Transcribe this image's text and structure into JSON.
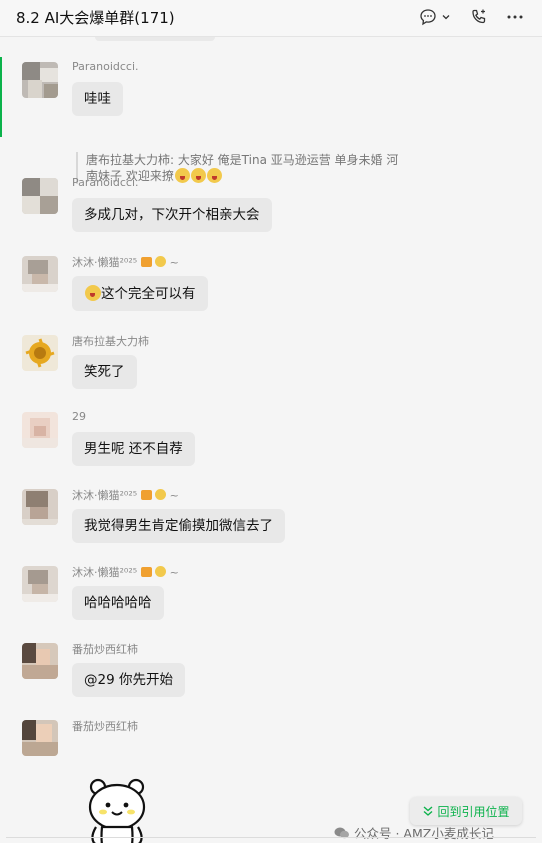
{
  "header": {
    "title": "8.2 AI大会爆单群(171)",
    "icons": [
      "chat-bubble-icon",
      "chevron-down-icon",
      "phone-icon",
      "more-icon"
    ]
  },
  "messages": [
    {
      "name": "Paranoidcci.",
      "text": "哇哇",
      "quote": "唐布拉基大力柿: 大家好 俺是Tina 亚马逊运营 单身未婚 河南妹子 欢迎来撩"
    },
    {
      "name": "Paranoidcci.",
      "text": "多成几对，下次开个相亲大会"
    },
    {
      "name": "沐沐·懒猫²⁰²⁵",
      "name_suffix": "~",
      "text": "这个完全可以有"
    },
    {
      "name": "唐布拉基大力柿",
      "text": "笑死了"
    },
    {
      "name": "29",
      "text": "男生呢 还不自荐"
    },
    {
      "name": "沐沐·懒猫²⁰²⁵",
      "name_suffix": "~",
      "text": "我觉得男生肯定偷摸加微信去了"
    },
    {
      "name": "沐沐·懒猫²⁰²⁵",
      "name_suffix": "~",
      "text": "哈哈哈哈哈"
    },
    {
      "name": "番茄炒西红柿",
      "text": "@29 你先开始"
    },
    {
      "name": "番茄炒西红柿",
      "sticker": "bear-sticker"
    }
  ],
  "jump_button": {
    "label": "回到引用位置",
    "icon": "double-chevron-down-icon"
  },
  "watermark": {
    "text": "公众号 · AMZ小麦成长记"
  },
  "colors": {
    "accent": "#0bb24b",
    "bubble": "#e8e8e8",
    "background": "#f5f5f5"
  }
}
